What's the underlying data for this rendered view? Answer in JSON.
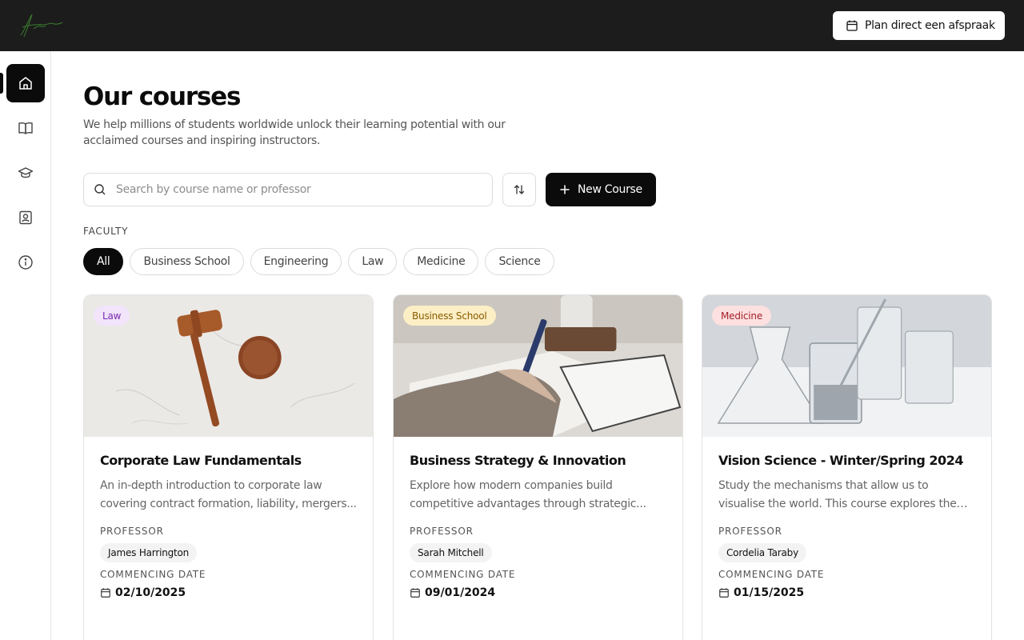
{
  "header": {
    "appointment_label": "Plan direct een afspraak"
  },
  "sidebar": {
    "items": [
      {
        "icon": "home-icon",
        "active": true
      },
      {
        "icon": "book-icon",
        "active": false
      },
      {
        "icon": "graduation-cap-icon",
        "active": false
      },
      {
        "icon": "contact-icon",
        "active": false
      },
      {
        "icon": "info-icon",
        "active": false
      }
    ]
  },
  "page": {
    "title": "Our courses",
    "subtitle": "We help millions of students worldwide unlock their learning potential with our acclaimed courses and inspiring instructors."
  },
  "search": {
    "placeholder": "Search by course name or professor",
    "value": ""
  },
  "toolbar": {
    "new_course_label": "New Course"
  },
  "faculty": {
    "label": "FACULTY",
    "options": [
      "All",
      "Business School",
      "Engineering",
      "Law",
      "Medicine",
      "Science"
    ],
    "selected": "All"
  },
  "courses": [
    {
      "faculty": "Law",
      "badge_bg": "#f1e4fb",
      "badge_color": "#7a2ab0",
      "title": "Corporate Law Fundamentals",
      "description": "An in-depth introduction to corporate law covering contract formation, liability, mergers...",
      "professor_label": "PROFESSOR",
      "professor": "James Harrington",
      "date_label": "COMMENCING DATE",
      "date": "02/10/2025"
    },
    {
      "faculty": "Business School",
      "badge_bg": "#fcefc5",
      "badge_color": "#8a5a00",
      "title": "Business Strategy & Innovation",
      "description": "Explore how modern companies build competitive advantages through strategic...",
      "professor_label": "PROFESSOR",
      "professor": "Sarah Mitchell",
      "date_label": "COMMENCING DATE",
      "date": "09/01/2024"
    },
    {
      "faculty": "Medicine",
      "badge_bg": "#fde0e0",
      "badge_color": "#a3202a",
      "title": "Vision Science - Winter/Spring 2024",
      "description": "Study the mechanisms that allow us to visualise the world. This course explores the sensory...",
      "professor_label": "PROFESSOR",
      "professor": "Cordelia Taraby",
      "date_label": "COMMENCING DATE",
      "date": "01/15/2025"
    }
  ]
}
